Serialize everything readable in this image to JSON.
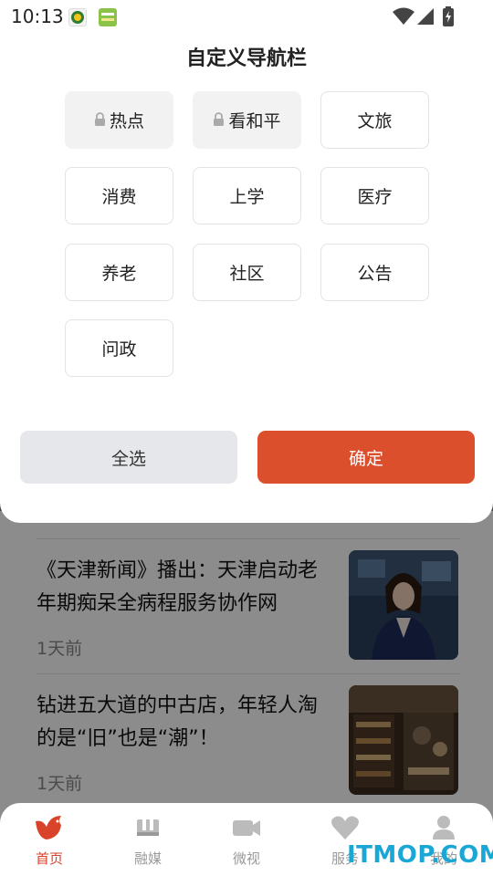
{
  "status_bar": {
    "time": "10:13"
  },
  "dialog": {
    "title": "自定义导航栏",
    "channels": [
      {
        "label": "热点",
        "locked": true
      },
      {
        "label": "看和平",
        "locked": true
      },
      {
        "label": "文旅",
        "locked": false
      },
      {
        "label": "消费",
        "locked": false
      },
      {
        "label": "上学",
        "locked": false
      },
      {
        "label": "医疗",
        "locked": false
      },
      {
        "label": "养老",
        "locked": false
      },
      {
        "label": "社区",
        "locked": false
      },
      {
        "label": "公告",
        "locked": false
      },
      {
        "label": "问政",
        "locked": false
      }
    ],
    "select_all_label": "全选",
    "confirm_label": "确定"
  },
  "feed": [
    {
      "title": "《天津新闻》播出：天津启动老年期痴呆全病程服务协作网",
      "time": "1天前"
    },
    {
      "title": "钻进五大道的中古店，年轻人淘的是“旧”也是“潮”！",
      "time": "1天前"
    }
  ],
  "tabbar": {
    "items": [
      {
        "label": "首页",
        "icon": "home-bird-icon",
        "active": true
      },
      {
        "label": "融媒",
        "icon": "media-icon",
        "active": false
      },
      {
        "label": "微视",
        "icon": "video-camera-icon",
        "active": false
      },
      {
        "label": "服务",
        "icon": "heart-icon",
        "active": false
      },
      {
        "label": "我的",
        "icon": "user-icon",
        "active": false
      }
    ]
  },
  "watermark": "ITMOP.COM",
  "colors": {
    "accent": "#db4f2c",
    "active_tab": "#d9432a",
    "watermark": "#1aa7d6"
  }
}
